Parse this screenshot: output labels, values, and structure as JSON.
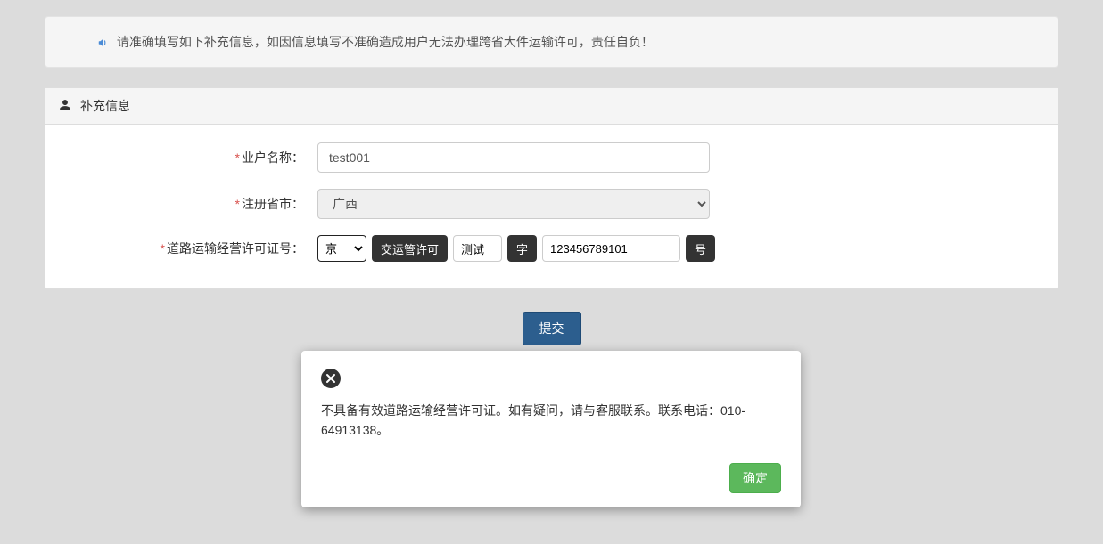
{
  "alert": {
    "text": "请准确填写如下补充信息，如因信息填写不准确造成用户无法办理跨省大件运输许可，责任自负！"
  },
  "panel": {
    "title": "补充信息"
  },
  "form": {
    "owner_name": {
      "label": "业户名称：",
      "value": "test001"
    },
    "province": {
      "label": "注册省市：",
      "value": "广西"
    },
    "license": {
      "label": "道路运输经营许可证号：",
      "sel_value": "京",
      "tag_text": "交运管许可",
      "text1": "测试",
      "char": "字",
      "number": "123456789101",
      "suffix": "号"
    }
  },
  "submit_label": "提交",
  "modal": {
    "message": "不具备有效道路运输经营许可证。如有疑问，请与客服联系。联系电话：010-64913138。",
    "ok_label": "确定"
  }
}
